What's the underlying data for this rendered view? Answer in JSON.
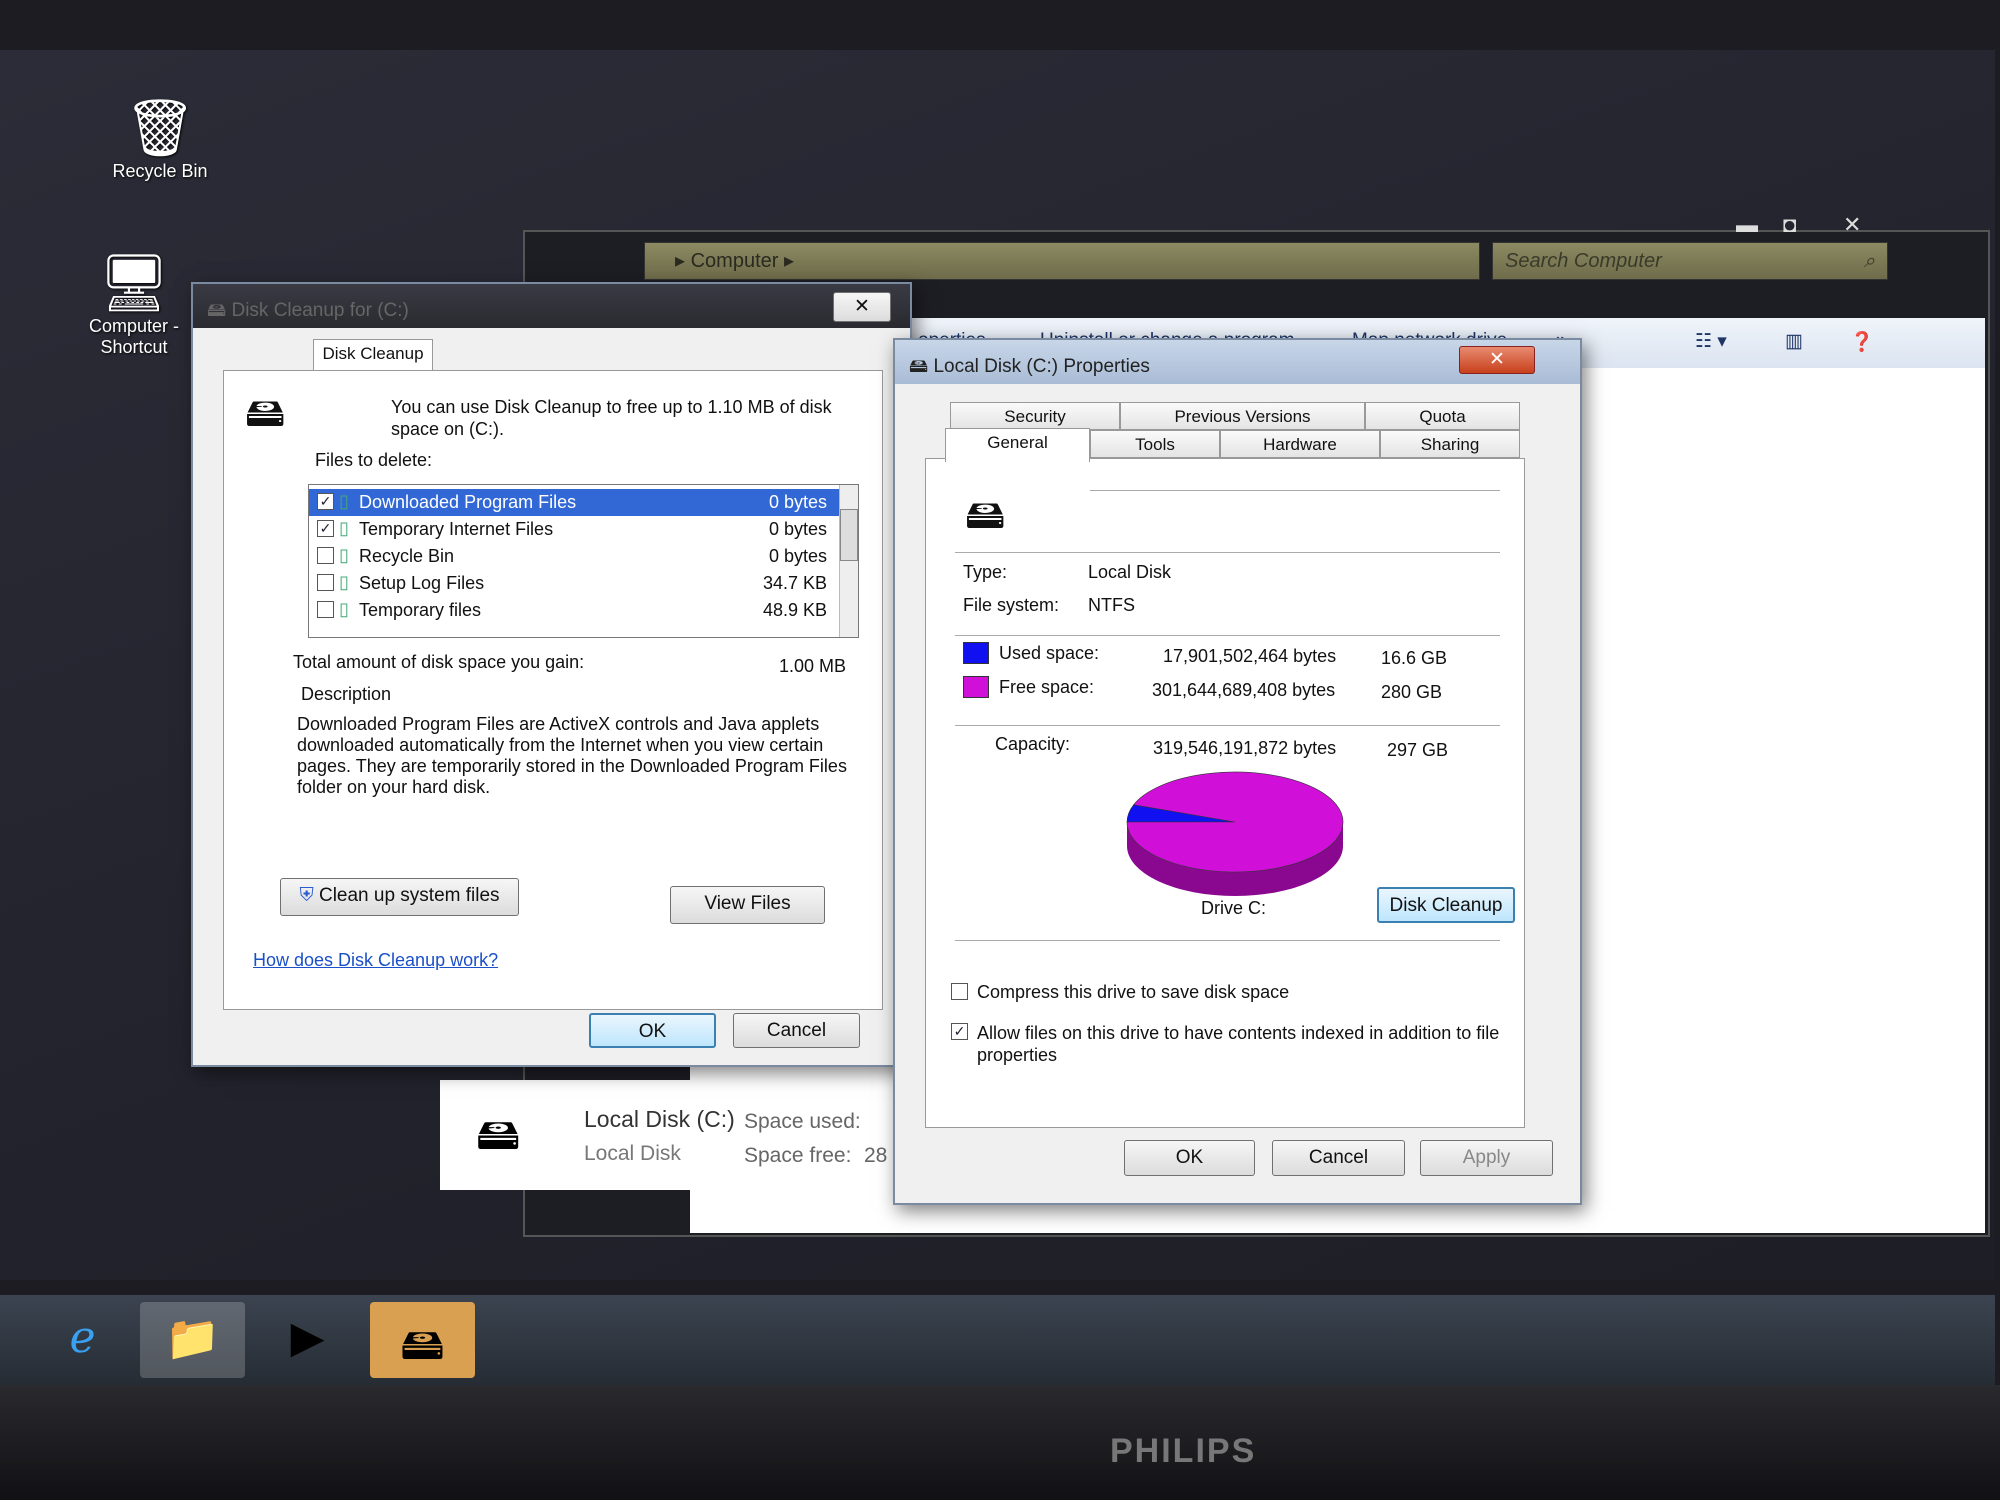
{
  "desktop": {
    "icons": [
      {
        "label": "Recycle Bin",
        "icon": "recycle-bin-icon"
      },
      {
        "label": "Computer - Shortcut",
        "icon": "computer-icon"
      }
    ]
  },
  "explorer": {
    "breadcrumb": "Computer",
    "search_placeholder": "Search Computer",
    "toolbar": [
      "operties",
      "Uninstall or change a program",
      "Map network drive",
      "»"
    ],
    "drive": {
      "name": "Local Disk (C:)",
      "type": "Local Disk",
      "space_used_label": "Space used:",
      "space_free_label": "Space free:",
      "space_free_partial": "28"
    }
  },
  "disk_cleanup": {
    "title": "Disk Cleanup for (C:)",
    "tab": "Disk Cleanup",
    "message": "You can use Disk Cleanup to free up to 1.10 MB of disk space on  (C:).",
    "files_label": "Files to delete:",
    "files": [
      {
        "name": "Downloaded Program Files",
        "size": "0 bytes",
        "checked": true,
        "selected": true
      },
      {
        "name": "Temporary Internet Files",
        "size": "0 bytes",
        "checked": true
      },
      {
        "name": "Recycle Bin",
        "size": "0 bytes",
        "checked": false
      },
      {
        "name": "Setup Log Files",
        "size": "34.7 KB",
        "checked": false
      },
      {
        "name": "Temporary files",
        "size": "48.9 KB",
        "checked": false
      }
    ],
    "total_label": "Total amount of disk space you gain:",
    "total_value": "1.00 MB",
    "description_label": "Description",
    "description": "Downloaded Program Files are ActiveX controls and Java applets downloaded automatically from the Internet when you view certain pages. They are temporarily stored in the Downloaded Program Files folder on your hard disk.",
    "cleanup_system_button": "Clean up system files",
    "view_files_button": "View Files",
    "help_link": "How does Disk Cleanup work?",
    "ok": "OK",
    "cancel": "Cancel"
  },
  "properties": {
    "title": "Local Disk (C:) Properties",
    "tabs_row1": [
      "Security",
      "Previous Versions",
      "Quota"
    ],
    "tabs_row2": [
      "General",
      "Tools",
      "Hardware",
      "Sharing"
    ],
    "active_tab": "General",
    "type_label": "Type:",
    "type": "Local Disk",
    "fs_label": "File system:",
    "fs": "NTFS",
    "used_label": "Used space:",
    "used_bytes": "17,901,502,464 bytes",
    "used_gb": "16.6 GB",
    "free_label": "Free space:",
    "free_bytes": "301,644,689,408 bytes",
    "free_gb": "280 GB",
    "capacity_label": "Capacity:",
    "capacity_bytes": "319,546,191,872 bytes",
    "capacity_gb": "297 GB",
    "drive_label": "Drive C:",
    "disk_cleanup_button": "Disk Cleanup",
    "compress_label": "Compress this drive to save disk space",
    "compress_checked": false,
    "index_label": "Allow files on this drive to have contents indexed in addition to file properties",
    "index_checked": true,
    "ok": "OK",
    "cancel": "Cancel",
    "apply": "Apply",
    "colors": {
      "used": "#1010f0",
      "free": "#d010d8"
    }
  },
  "chart_data": {
    "type": "pie",
    "categories": [
      "Used space",
      "Free space"
    ],
    "values": [
      17901502464,
      301644689408
    ],
    "colors": [
      "#1010f0",
      "#d010d8"
    ]
  },
  "monitor": {
    "brand": "PHILIPS"
  }
}
